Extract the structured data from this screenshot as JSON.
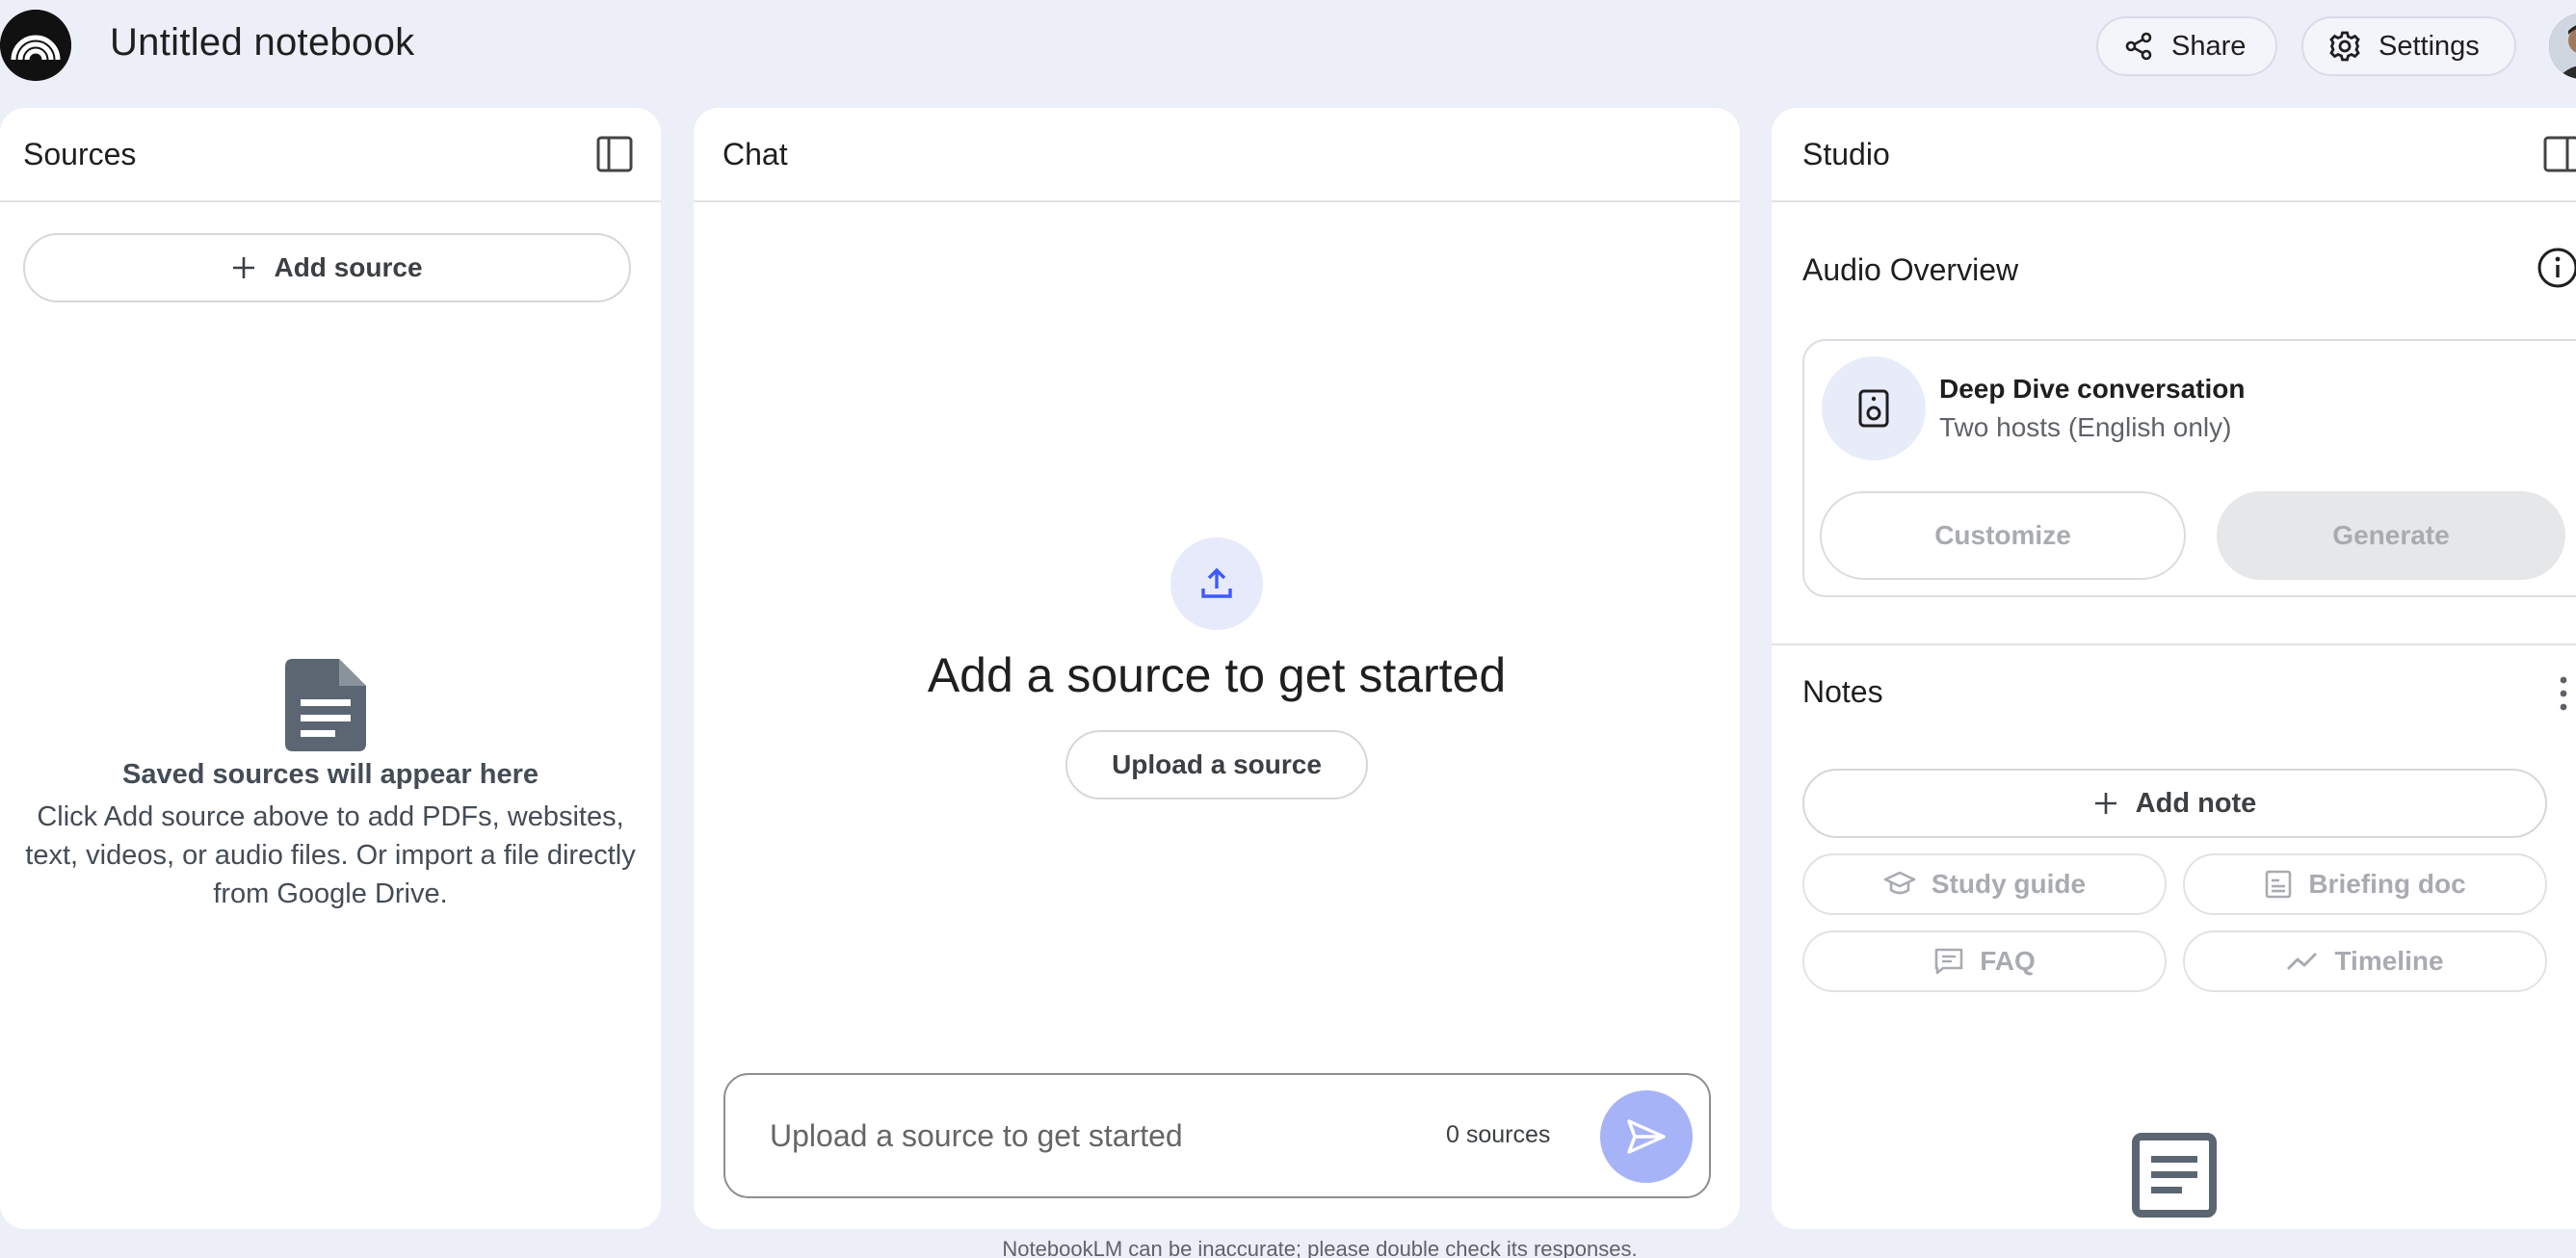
{
  "header": {
    "notebook_title": "Untitled notebook",
    "share_label": "Share",
    "settings_label": "Settings"
  },
  "sources": {
    "title": "Sources",
    "add_source_label": "Add source",
    "empty_heading": "Saved sources will appear here",
    "empty_body": "Click Add source above to add PDFs, websites, text, videos, or audio files. Or import a file directly from Google Drive."
  },
  "chat": {
    "title": "Chat",
    "heading": "Add a source to get started",
    "upload_button": "Upload a source",
    "input_placeholder": "Upload a source to get started",
    "sources_count": "0 sources"
  },
  "studio": {
    "title": "Studio",
    "audio_overview_title": "Audio Overview",
    "audio_card": {
      "title": "Deep Dive conversation",
      "subtitle": "Two hosts (English only)",
      "customize_label": "Customize",
      "generate_label": "Generate"
    },
    "notes_title": "Notes",
    "add_note_label": "Add note",
    "note_chips": {
      "study_guide": "Study guide",
      "briefing_doc": "Briefing doc",
      "faq": "FAQ",
      "timeline": "Timeline"
    }
  },
  "footer": {
    "disclaimer": "NotebookLM can be inaccurate; please double check its responses."
  },
  "colors": {
    "page_background": "#eceef8",
    "send_button": "#a7b3f7",
    "accent_blue": "#3d5afe"
  }
}
